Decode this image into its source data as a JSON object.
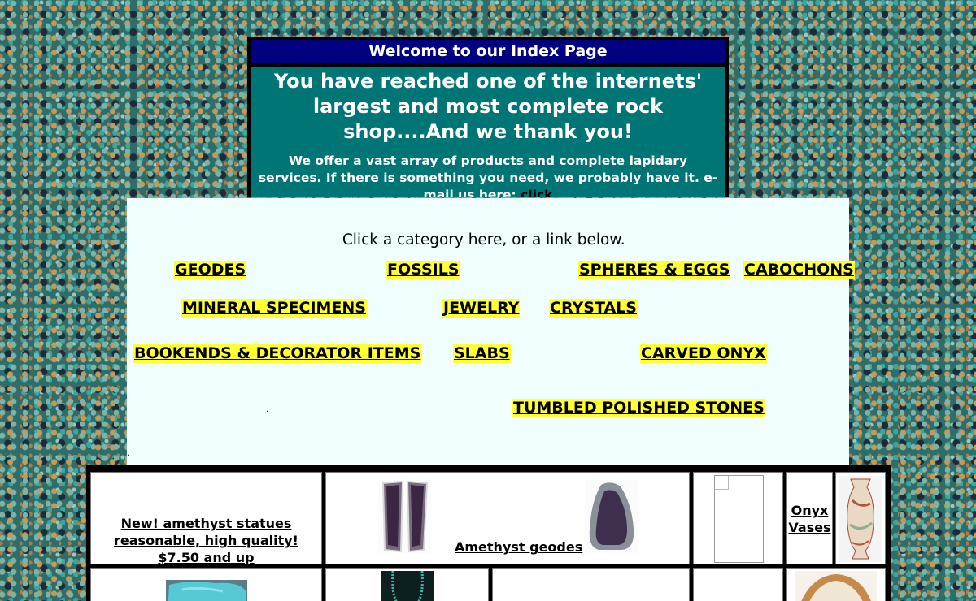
{
  "welcome": {
    "title": "Welcome to our Index Page",
    "lead": "You have reached one of the internets' largest and most complete rock shop....And we thank you!",
    "sub": "We offer a vast array of products and complete lapidary services. If there is something you need, we probably have it. e-mail us here: ",
    "email_link": "click"
  },
  "panel": {
    "prompt_dot": ".",
    "prompt": "Click a category here, or a link below.",
    "categories": [
      "GEODES",
      "FOSSILS",
      "SPHERES & EGGS",
      "CABOCHONS",
      "MINERAL SPECIMENS",
      "JEWELRY",
      "CRYSTALS",
      "BOOKENDS & DECORATOR ITEMS",
      "SLABS",
      "CARVED ONYX",
      "TUMBLED POLISHED STONES"
    ],
    "stray_dot": "."
  },
  "products": {
    "statues_link": "New! amethyst statues reasonable, high quality! $7.50 and up",
    "geodes_link": "Amethyst geodes",
    "onyx_link": "Onyx Vases"
  },
  "colors": {
    "title_bar": "#000080",
    "welcome_body": "#007575",
    "category_highlight": "#ffff33",
    "panel_bg": "#f0fefe"
  }
}
